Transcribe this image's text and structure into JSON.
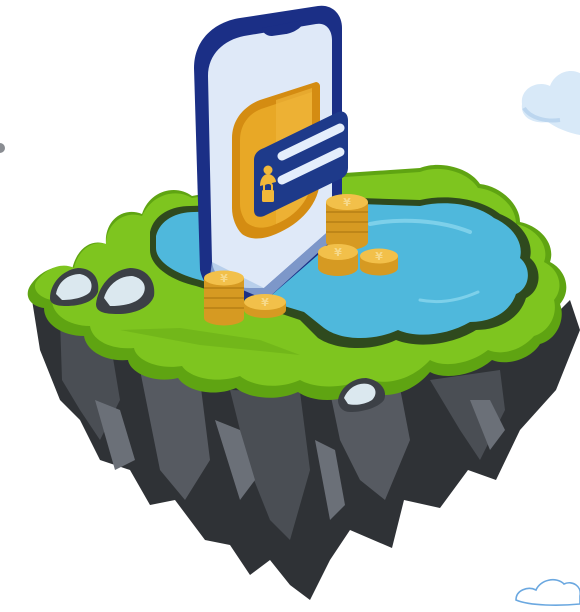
{
  "scene": {
    "coin_symbol": "¥",
    "icons": [
      "floating-island",
      "cloud-icon",
      "smartphone",
      "shield-icon",
      "id-card-icon",
      "padlock-icon",
      "user-icon",
      "coin-stack",
      "rock",
      "pond"
    ],
    "colors": {
      "grass": "#7ec51f",
      "grass_dark": "#5fa412",
      "water": "#4fb8dc",
      "rock_dark": "#2f3236",
      "rock_mid": "#4a4e54",
      "rock_light": "#6b7078",
      "phone_frame": "#1b2f86",
      "phone_screen": "#dfe9f8",
      "shield": "#e2a21f",
      "card": "#1e3a8a",
      "coin": "#e7b23a",
      "cloud": "#d8e9f8"
    }
  }
}
